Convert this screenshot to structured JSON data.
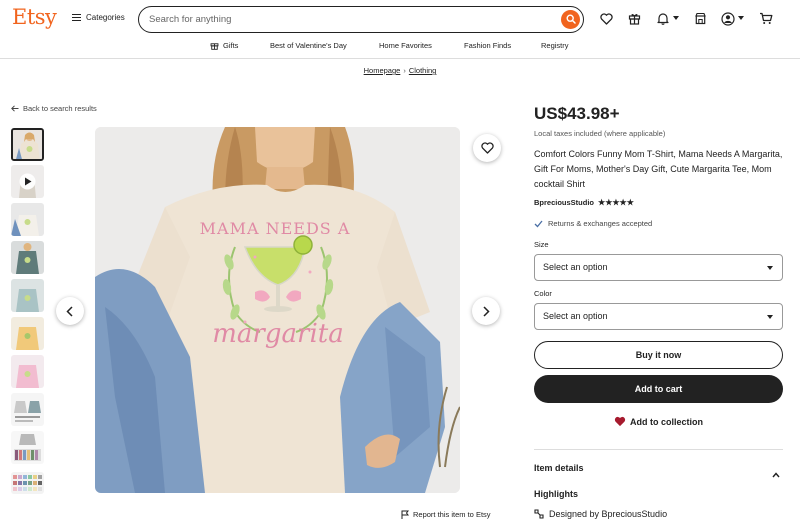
{
  "header": {
    "logo": "Etsy",
    "categories_label": "Categories",
    "search_placeholder": "Search for anything"
  },
  "nav": {
    "gifts": "Gifts",
    "valentines": "Best of Valentine's Day",
    "home_favorites": "Home Favorites",
    "fashion_finds": "Fashion Finds",
    "registry": "Registry"
  },
  "breadcrumb": {
    "homepage": "Homepage",
    "separator": "›",
    "clothing": "Clothing"
  },
  "back_link": "Back to search results",
  "main_image": {
    "shirt_text_top": "MAMA NEEDS A",
    "shirt_text_bottom": "margarita"
  },
  "report": "Report this item to Etsy",
  "product": {
    "price": "US$43.98+",
    "tax_note": "Local taxes included (where applicable)",
    "title": "Comfort Colors Funny Mom T-Shirt, Mama Needs A Margarita, Gift For Moms, Mother's Day Gift, Cute Margarita Tee, Mom cocktail Shirt",
    "seller": "BpreciousStudio",
    "stars": "★★★★★",
    "rating": 5,
    "returns": "Returns & exchanges accepted",
    "size_label": "Size",
    "size_value": "Select an option",
    "color_label": "Color",
    "color_value": "Select an option",
    "buy_now": "Buy it now",
    "add_to_cart": "Add to cart",
    "add_to_collection": "Add to collection",
    "item_details": "Item details",
    "highlights": "Highlights",
    "designed_by": "Designed by BpreciousStudio"
  },
  "colors": {
    "brand": "#f1641e",
    "dark": "#222222",
    "favorite": "#a61a2e"
  }
}
